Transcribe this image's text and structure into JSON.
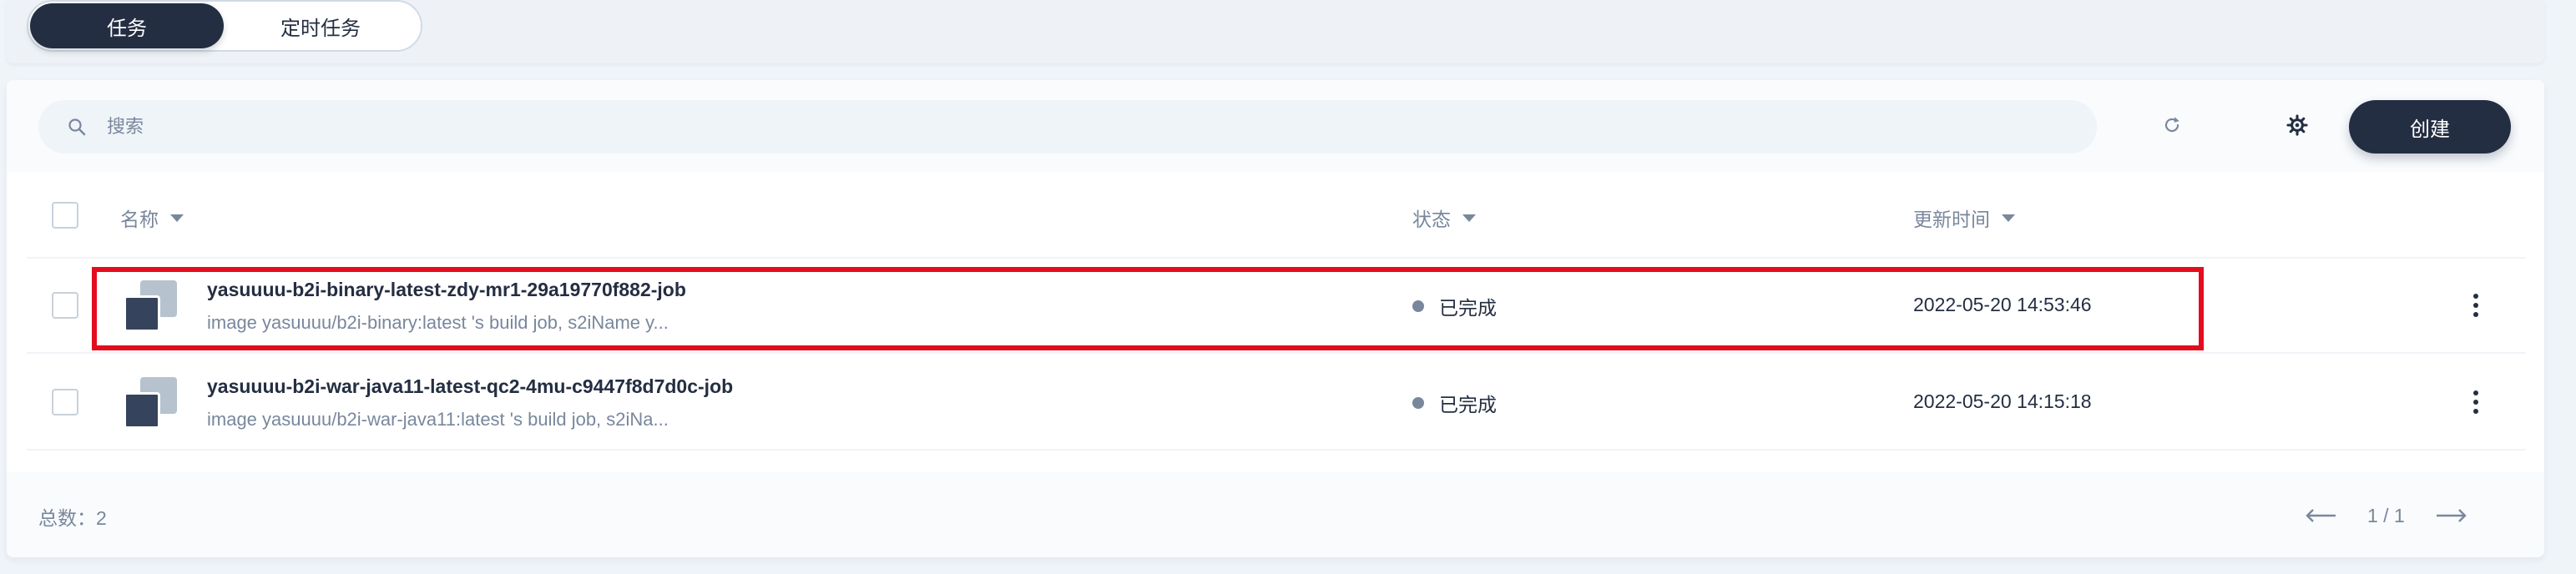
{
  "tabs": [
    {
      "label": "任务",
      "active": true
    },
    {
      "label": "定时任务",
      "active": false
    }
  ],
  "toolbar": {
    "search_placeholder": "搜索",
    "refresh_icon": "refresh-icon",
    "settings_icon": "gear-icon",
    "create_label": "创建"
  },
  "table": {
    "headers": {
      "name": "名称",
      "status": "状态",
      "updated": "更新时间"
    },
    "rows": [
      {
        "name": "yasuuuu-b2i-binary-latest-zdy-mr1-29a19770f882-job",
        "description": "image yasuuuu/b2i-binary:latest 's build job, s2iName y...",
        "status": "已完成",
        "updated": "2022-05-20 14:53:46",
        "highlighted": true
      },
      {
        "name": "yasuuuu-b2i-war-java11-latest-qc2-4mu-c9447f8d7d0c-job",
        "description": "image yasuuuu/b2i-war-java11:latest 's build job, s2iNa...",
        "status": "已完成",
        "updated": "2022-05-20 14:15:18",
        "highlighted": false
      }
    ]
  },
  "footer": {
    "total": "总数：2",
    "page": "1 / 1"
  },
  "colors": {
    "primary": "#242e42",
    "muted": "#79879c",
    "background": "#eff4f9",
    "highlight_border": "#e30d1d",
    "status_dot": "#79879c"
  }
}
